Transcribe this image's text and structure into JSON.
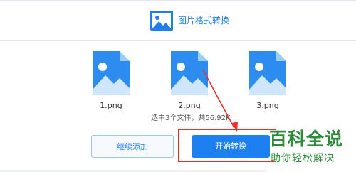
{
  "header": {
    "title": "图片格式转换",
    "icon": "image-icon"
  },
  "files": [
    {
      "name": "1.png",
      "icon": "image-file-icon"
    },
    {
      "name": "2.png",
      "icon": "image-file-icon"
    },
    {
      "name": "3.png",
      "icon": "image-file-icon"
    }
  ],
  "summary": "选中3个文件，共56.92K",
  "buttons": {
    "continue_add": "继续添加",
    "start_convert": "开始转换"
  },
  "watermark": {
    "main": "百科全说",
    "sub": "助你轻松解决"
  },
  "colors": {
    "accent": "#1d7ff0",
    "annotation": "#e4312b",
    "watermark": "#2e8b3c"
  }
}
